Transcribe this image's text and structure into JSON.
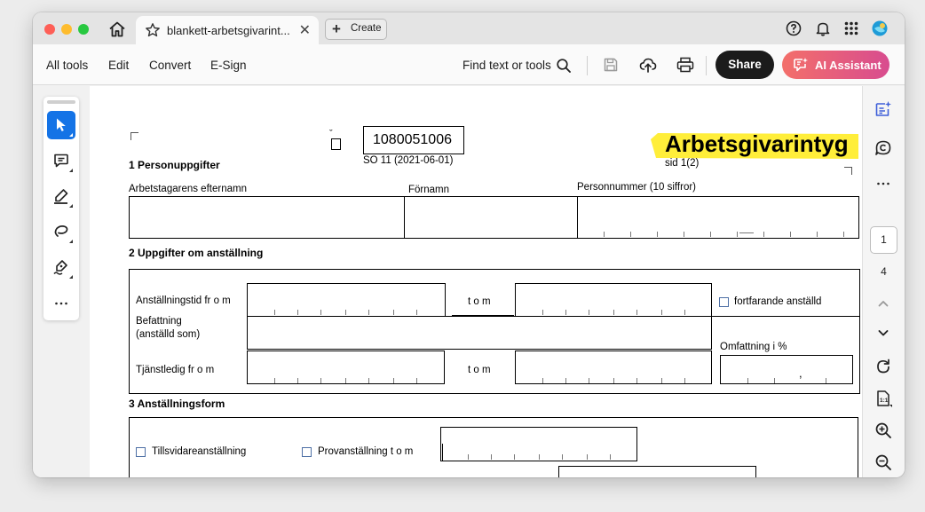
{
  "window": {
    "tab_title": "blankett-arbetsgivarint...",
    "create_label": "Create"
  },
  "toolbar": {
    "menu": [
      "All tools",
      "Edit",
      "Convert",
      "E-Sign"
    ],
    "find_label": "Find text or tools",
    "share_label": "Share",
    "ai_label": "AI Assistant"
  },
  "colors": {
    "selected_tool": "#1473e6",
    "share_bg": "#1b1b1b",
    "ai_gradient": [
      "#f36f6a",
      "#d84c8f"
    ],
    "highlight": "#ffee3a"
  },
  "icons": {
    "left_tools": [
      "select-arrow-icon",
      "comment-icon",
      "highlight-pen-icon",
      "freehand-draw-icon",
      "signature-icon",
      "more-icon"
    ],
    "right_rail": [
      "ai-summary-icon",
      "comments-panel-icon",
      "more-icon",
      "chevron-up-icon",
      "chevron-down-icon",
      "rotate-icon",
      "fit-page-icon",
      "zoom-in-icon",
      "zoom-out-icon"
    ]
  },
  "pagination": {
    "current_page": "1",
    "total_pages": "4"
  },
  "document": {
    "form_number": "1080051006",
    "form_code": "SO 11 (2021-06-01)",
    "title": "Arbetsgivarintyg",
    "page_label": "sid 1(2)",
    "section1": {
      "heading": "1 Personuppgifter",
      "last_name": "Arbetstagarens efternamn",
      "first_name": "Förnamn",
      "personal_number": "Personnummer (10 siffror)"
    },
    "section2": {
      "heading": "2 Uppgifter om anställning",
      "employment_from": "Anställningstid fr o m",
      "to1": "t o m",
      "ongoing": "fortfarande anställd",
      "position_line1": "Befattning",
      "position_line2": "(anställd som)",
      "scope": "Omfattning i %",
      "leave_from": "Tjänstledig fr o m",
      "to2": "t o m",
      "comma": ","
    },
    "section3": {
      "heading": "3 Anställningsform",
      "permanent": "Tillsvidareanställning",
      "probation": "Provanställning t o m"
    }
  }
}
